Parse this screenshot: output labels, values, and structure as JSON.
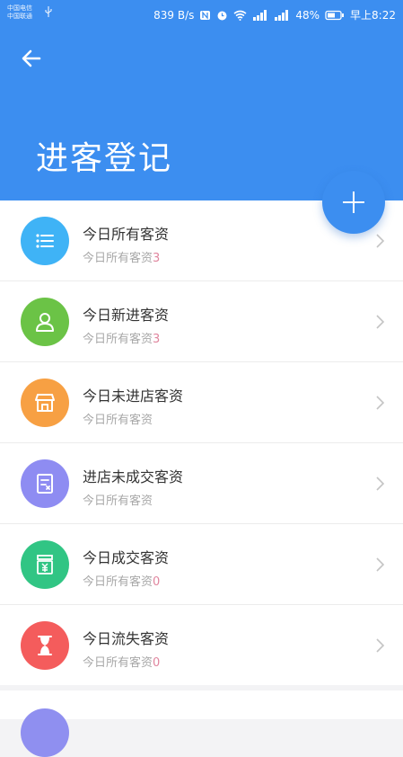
{
  "status_bar": {
    "carrier_line1": "中国电信",
    "carrier_line2": "中国联通",
    "net_speed": "839 B/s",
    "battery": "48%",
    "time": "早上8:22"
  },
  "header": {
    "title": "进客登记",
    "color": "#3c8ef0"
  },
  "items": [
    {
      "title": "今日所有客资",
      "sub_label": "今日所有客资",
      "count": "3",
      "icon": "list-icon",
      "color": "#3fb3f6"
    },
    {
      "title": "今日新进客资",
      "sub_label": "今日所有客资",
      "count": "3",
      "icon": "person-icon",
      "color": "#6bc346"
    },
    {
      "title": "今日未进店客资",
      "sub_label": "今日所有客资",
      "count": "",
      "icon": "store-icon",
      "color": "#f7a043"
    },
    {
      "title": "进店未成交客资",
      "sub_label": "今日所有客资",
      "count": "",
      "icon": "document-icon",
      "color": "#8e8cf2"
    },
    {
      "title": "今日成交客资",
      "sub_label": "今日所有客资",
      "count": "0",
      "icon": "money-icon",
      "color": "#31c584"
    },
    {
      "title": "今日流失客资",
      "sub_label": "今日所有客资",
      "count": "0",
      "icon": "hourglass-icon",
      "color": "#f45c5c"
    }
  ]
}
